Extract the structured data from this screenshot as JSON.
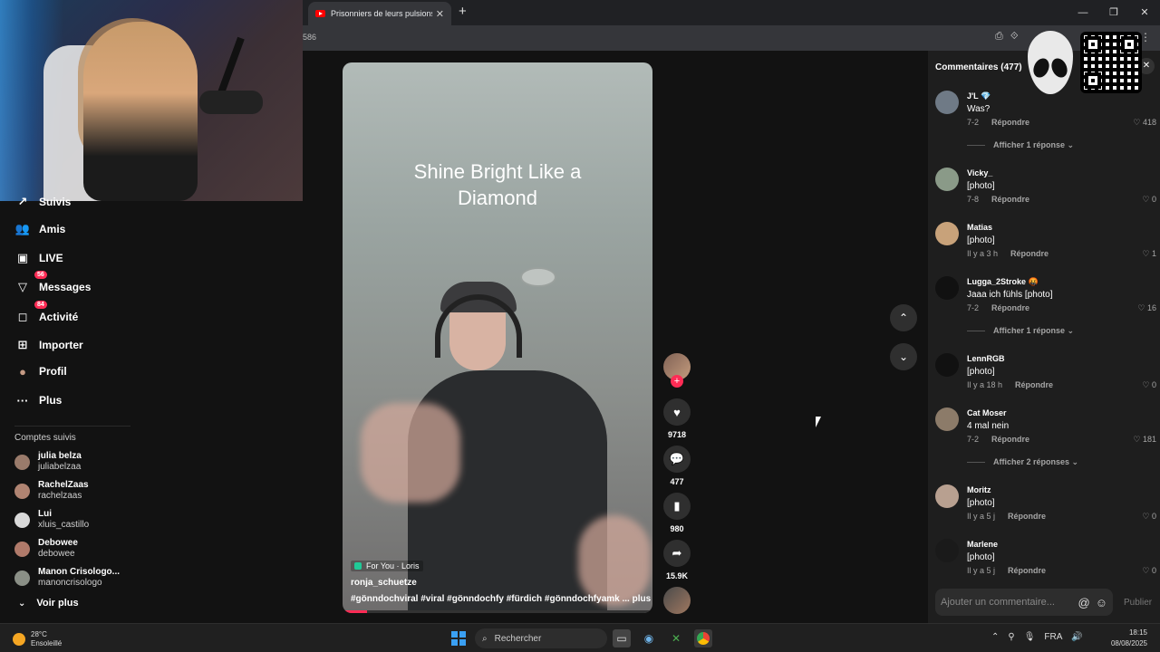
{
  "browser": {
    "tab_title": "Prisonniers de leurs pulsions - Y",
    "tab_close": "✕",
    "new_tab": "+",
    "address": "586",
    "win_min": "—",
    "win_max": "❐",
    "win_close": "✕",
    "menu": "⋮"
  },
  "sidebar": {
    "items": [
      {
        "label": "Suivis",
        "icon": "↗"
      },
      {
        "label": "Amis",
        "icon": "👥"
      },
      {
        "label": "LIVE",
        "icon": "▣"
      },
      {
        "label": "Messages",
        "icon": "▽",
        "badge": "56"
      },
      {
        "label": "Activité",
        "icon": "◻",
        "badge": "84"
      },
      {
        "label": "Importer",
        "icon": "⊞"
      },
      {
        "label": "Profil",
        "icon": "●"
      },
      {
        "label": "Plus",
        "icon": "···"
      }
    ],
    "section_title": "Comptes suivis",
    "accounts": [
      {
        "name": "julia belza",
        "handle": "juliabelzaa"
      },
      {
        "name": "RachelZaas",
        "handle": "rachelzaas"
      },
      {
        "name": "Lui",
        "handle": "xluis_castillo"
      },
      {
        "name": "Debowee",
        "handle": "debowee"
      },
      {
        "name": "Manon Crisologo...",
        "handle": "manoncrisologo"
      }
    ],
    "see_more": "Voir plus",
    "see_more_icon": "⌄"
  },
  "video": {
    "caption_line1": "Shine Bright Like a",
    "caption_line2": "Diamond",
    "for_you": "For You · Loris",
    "author": "ronja_schuetze",
    "hashtags": "#gönndochviral #viral #gönndochfy #fürdich #gönndochfyamk ...",
    "more": "plus",
    "progress": 0.08
  },
  "actions": {
    "likes": "9718",
    "comments": "477",
    "saves": "980",
    "shares": "15.9K",
    "like_icon": "♥",
    "comment_icon": "💬",
    "save_icon": "▮",
    "share_icon": "➦",
    "follow_icon": "+",
    "up_icon": "⌃",
    "down_icon": "⌄"
  },
  "comments_panel": {
    "title": "Commentaires (477)",
    "close_icon": "✕",
    "reply_label": "Répondre",
    "like_icon": "♡",
    "comments": [
      {
        "name": "J'L 💎",
        "text": "Was?",
        "time": "7-2",
        "likes": "418",
        "more": "Afficher 1 réponse ⌄"
      },
      {
        "name": "Vicky_",
        "text": "[photo]",
        "time": "7-8",
        "likes": "0",
        "more": ""
      },
      {
        "name": "Matias",
        "text": "[photo]",
        "time": "Il y a 3 h",
        "likes": "1",
        "more": ""
      },
      {
        "name": "Lugga_2Stroke 🤬",
        "text": "Jaaa ich fühls [photo]",
        "time": "7-2",
        "likes": "16",
        "more": "Afficher 1 réponse ⌄"
      },
      {
        "name": "LennRGB",
        "text": "[photo]",
        "time": "Il y a 18 h",
        "likes": "0",
        "more": ""
      },
      {
        "name": "Cat Moser",
        "text": "4 mal nein",
        "time": "7-2",
        "likes": "181",
        "more": "Afficher 2 réponses ⌄"
      },
      {
        "name": "Moritz",
        "text": "[photo]",
        "time": "Il y a 5 j",
        "likes": "0",
        "more": ""
      },
      {
        "name": "Marlene",
        "text": "[photo]",
        "time": "Il y a 5 j",
        "likes": "0",
        "more": ""
      }
    ],
    "input_placeholder": "Ajouter un commentaire...",
    "mention_icon": "@",
    "emoji_icon": "☺",
    "publish": "Publier"
  },
  "taskbar": {
    "temp": "28°C",
    "weather": "Ensoleillé",
    "search": "Rechercher",
    "search_icon": "⌕",
    "lang": "FRA",
    "time": "18:15",
    "date": "08/08/2025",
    "tray_up": "⌃",
    "tray_net": "⚲",
    "tray_mic": "🎙",
    "tray_vol": "🔊"
  }
}
